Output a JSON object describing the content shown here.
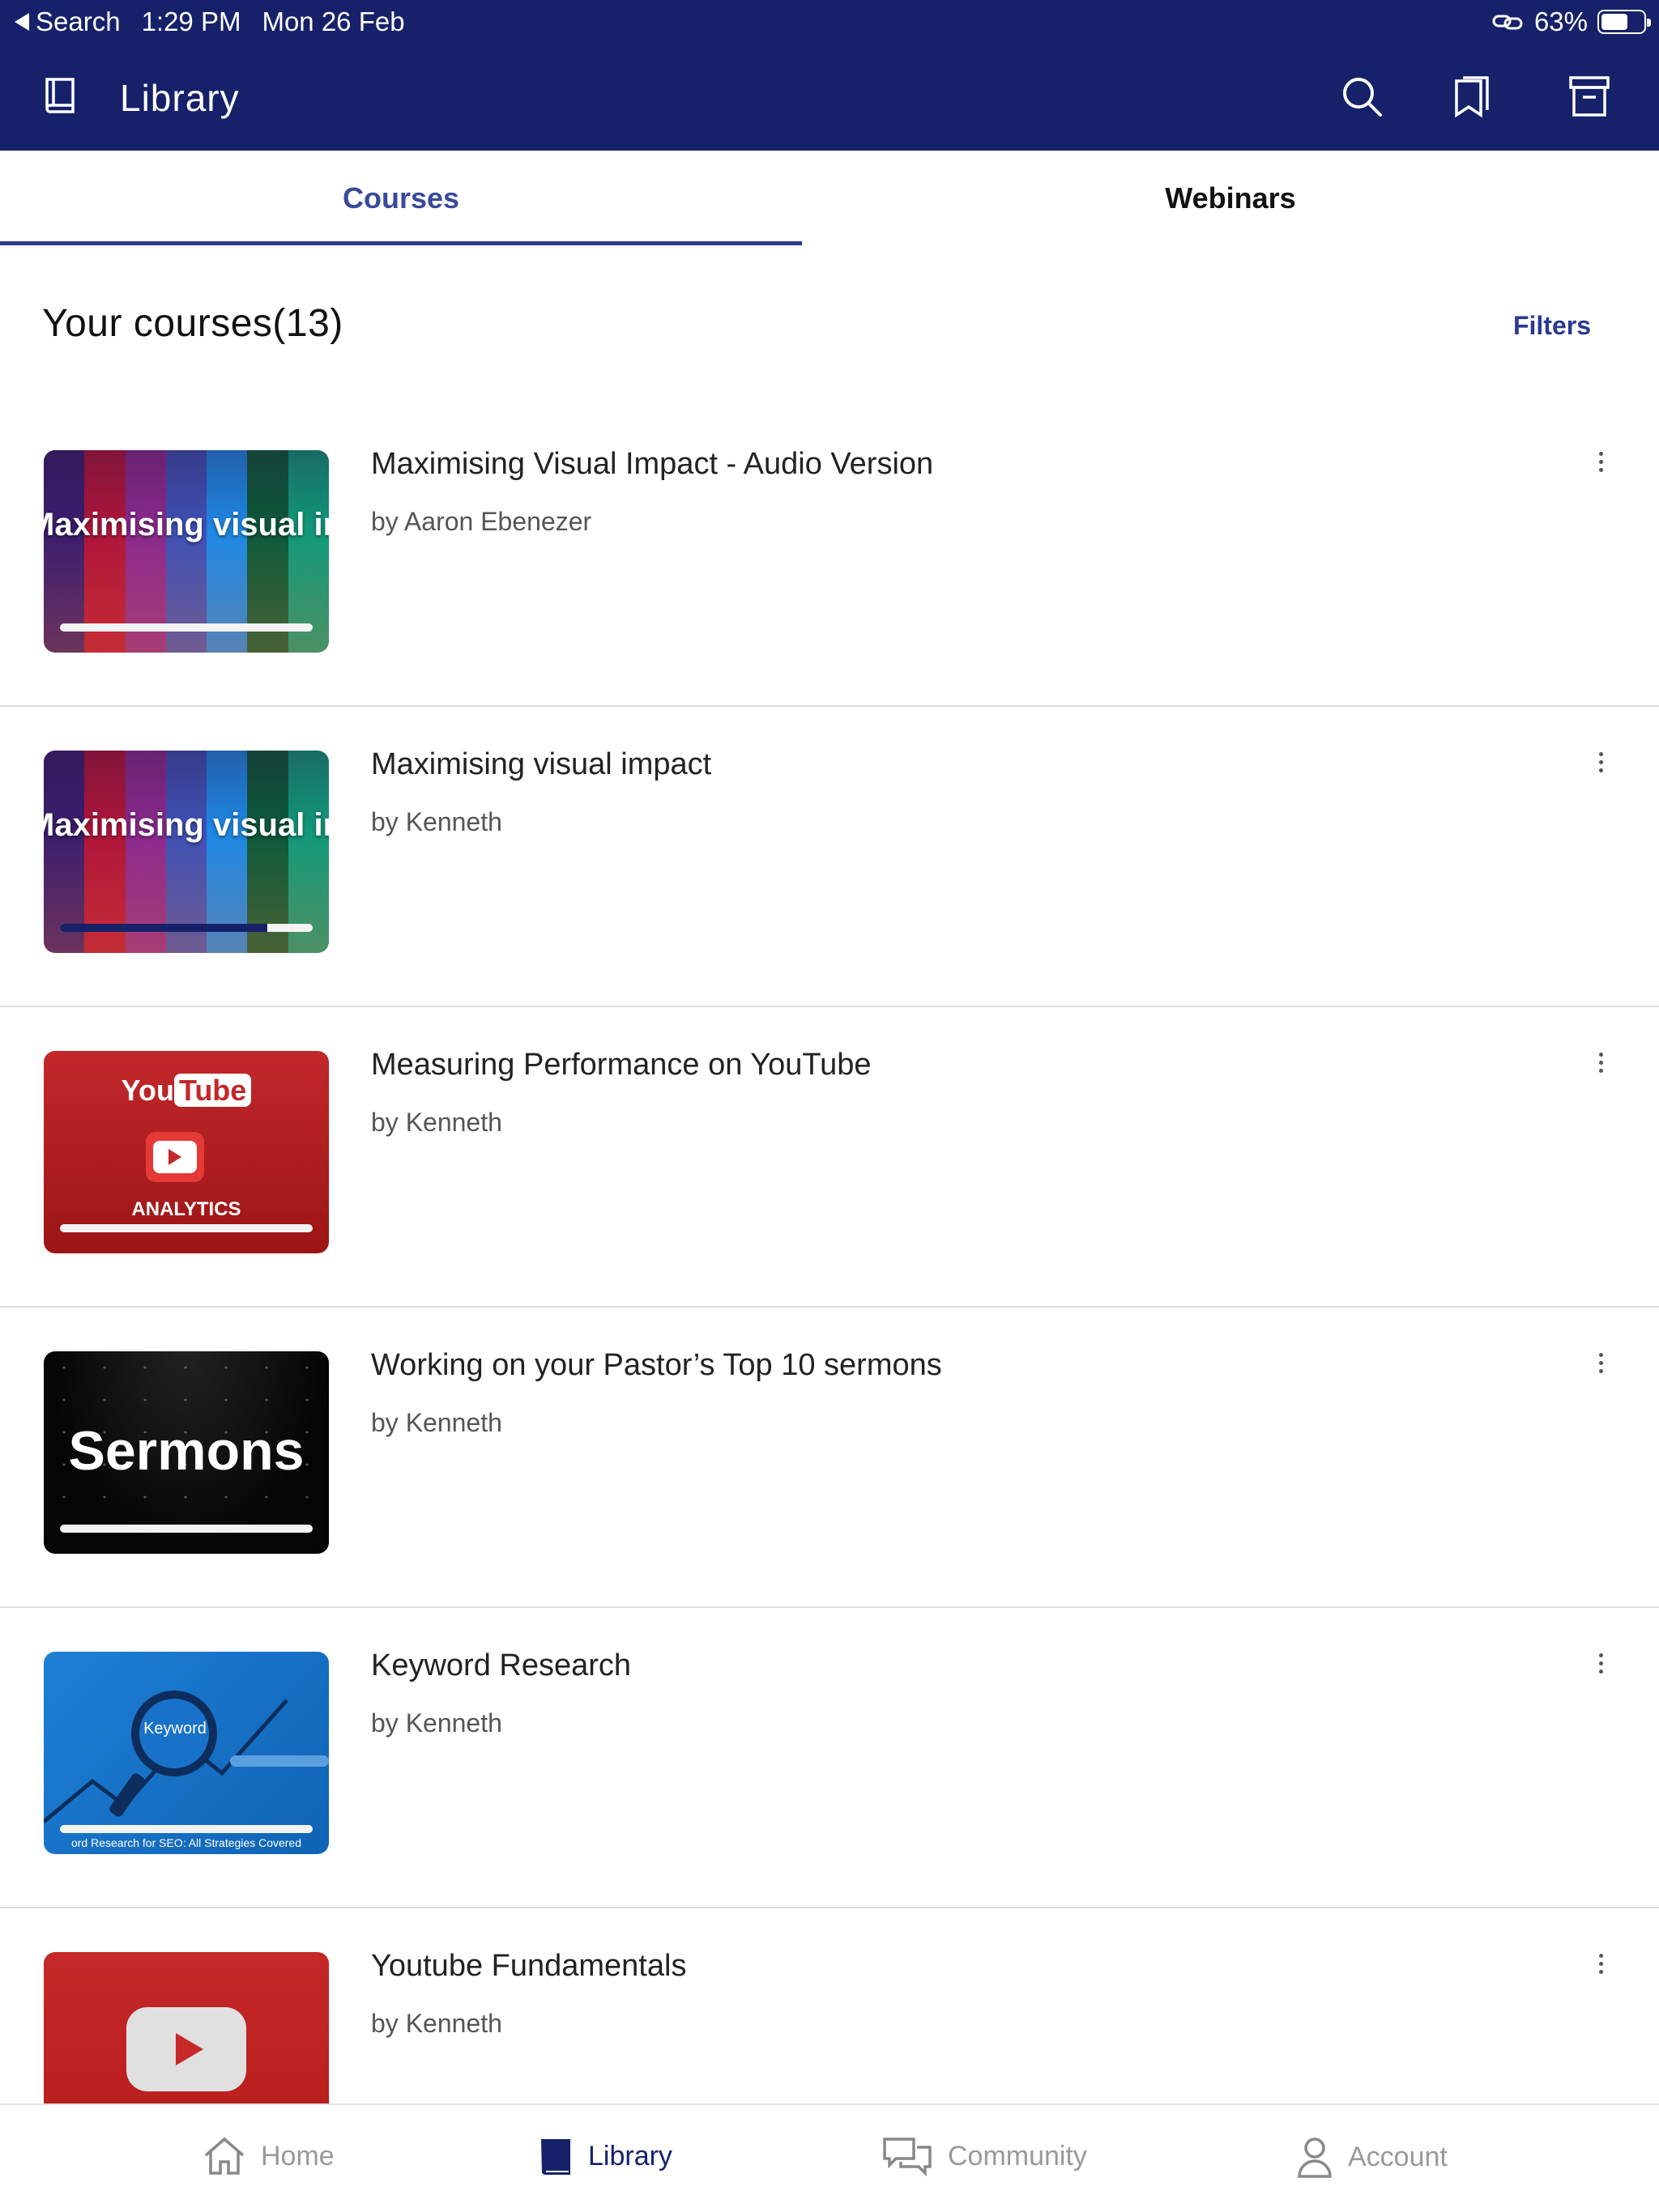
{
  "status_bar": {
    "back_label": "Search",
    "time": "1:29 PM",
    "date": "Mon 26 Feb",
    "battery": "63%",
    "battery_level": 0.63
  },
  "header": {
    "title": "Library"
  },
  "tabs": [
    {
      "label": "Courses",
      "active": true
    },
    {
      "label": "Webinars",
      "active": false
    }
  ],
  "section": {
    "title": "Your courses(13)",
    "filters_label": "Filters"
  },
  "courses": [
    {
      "title": "Maximising Visual Impact - Audio Version",
      "author": "by Aaron Ebenezer",
      "thumb_text": "Maximising visual impact",
      "progress": 0.0
    },
    {
      "title": "Maximising visual impact",
      "author": "by Kenneth",
      "thumb_text": "Maximising visual impact",
      "progress": 0.82
    },
    {
      "title": "Measuring Performance on YouTube",
      "author": "by Kenneth",
      "thumb_you": "You",
      "thumb_tube": "Tube",
      "thumb_caption": "ANALYTICS",
      "progress": 0.0
    },
    {
      "title": "Working on your Pastor’s Top 10 sermons",
      "author": "by Kenneth",
      "thumb_text": "Sermons",
      "progress": 0.0
    },
    {
      "title": "Keyword Research",
      "author": "by Kenneth",
      "thumb_text": "Keyword",
      "thumb_caption": "ord Research for SEO: All Strategies Covered",
      "progress": 0.0
    },
    {
      "title": "Youtube Fundamentals",
      "author": "by Kenneth"
    }
  ],
  "bottom_nav": [
    {
      "label": "Home",
      "icon": "home-icon",
      "active": false
    },
    {
      "label": "Library",
      "icon": "library-icon",
      "active": true
    },
    {
      "label": "Community",
      "icon": "community-icon",
      "active": false
    },
    {
      "label": "Account",
      "icon": "account-icon",
      "active": false
    }
  ],
  "colors": {
    "header_bg": "#16216a",
    "accent": "#2b3990"
  }
}
